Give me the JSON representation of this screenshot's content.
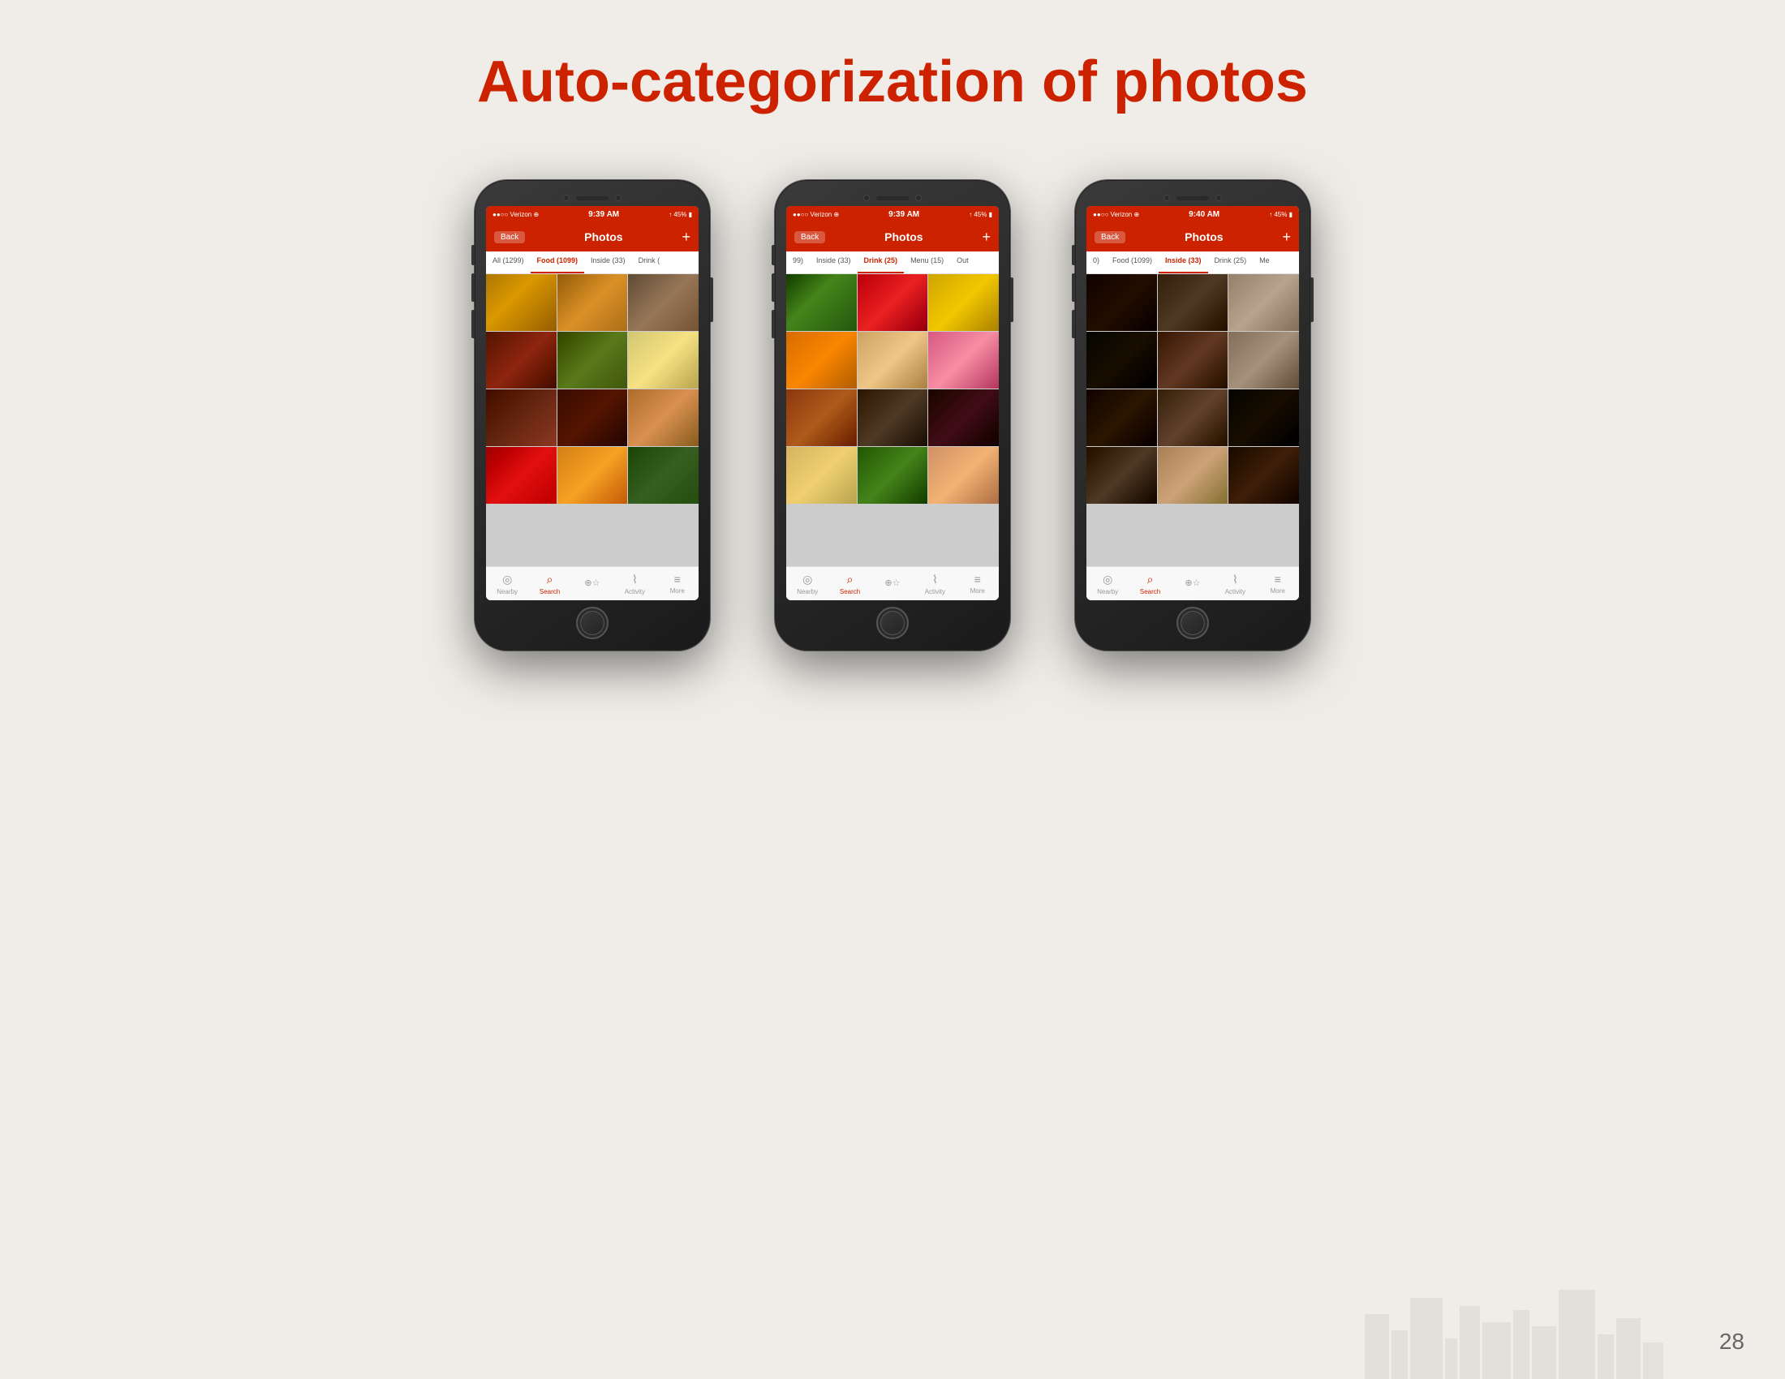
{
  "title": "Auto-categorization of photos",
  "page_number": "28",
  "phones": [
    {
      "id": "phone1",
      "status": {
        "carrier": "●●○○ Verizon ⊕",
        "time": "9:39 AM",
        "battery": "↑ 45% □"
      },
      "nav": {
        "back": "Back",
        "title": "Photos",
        "plus": "+"
      },
      "active_tab": "Food (1099)",
      "tabs": [
        "All (1299)",
        "Food (1099)",
        "Inside (33)",
        "Drink ("
      ],
      "bottom_tabs": [
        {
          "label": "Nearby",
          "icon": "◎",
          "active": false
        },
        {
          "label": "Search",
          "icon": "⌕",
          "active": true
        },
        {
          "label": "",
          "icon": "☆",
          "active": false
        },
        {
          "label": "Activity",
          "icon": "⌇",
          "active": false
        },
        {
          "label": "More",
          "icon": "≡",
          "active": false
        }
      ],
      "grid_classes": [
        "p-food1",
        "p-food2",
        "p-food3",
        "p-food4",
        "p-food5",
        "p-food6",
        "p-food7",
        "p-food8",
        "p-food9",
        "p-food10",
        "p-food11",
        "p-food12"
      ]
    },
    {
      "id": "phone2",
      "status": {
        "carrier": "●●○○ Verizon ⊕",
        "time": "9:39 AM",
        "battery": "↑ 45% □"
      },
      "nav": {
        "back": "Back",
        "title": "Photos",
        "plus": "+"
      },
      "active_tab": "Drink (25)",
      "tabs": [
        "99)",
        "Inside (33)",
        "Drink (25)",
        "Menu (15)",
        "Out"
      ],
      "bottom_tabs": [
        {
          "label": "Nearby",
          "icon": "◎",
          "active": false
        },
        {
          "label": "Search",
          "icon": "⌕",
          "active": true
        },
        {
          "label": "",
          "icon": "☆",
          "active": false
        },
        {
          "label": "Activity",
          "icon": "⌇",
          "active": false
        },
        {
          "label": "More",
          "icon": "≡",
          "active": false
        }
      ],
      "grid_classes": [
        "p-drink1",
        "p-drink2",
        "p-drink3",
        "p-drink4",
        "p-drink5",
        "p-drink6",
        "p-drink7",
        "p-drink8",
        "p-drink9",
        "p-drink10",
        "p-drink11",
        "p-drink12"
      ]
    },
    {
      "id": "phone3",
      "status": {
        "carrier": "●●○○ Verizon ⊕",
        "time": "9:40 AM",
        "battery": "↑ 45% □"
      },
      "nav": {
        "back": "Back",
        "title": "Photos",
        "plus": "+"
      },
      "active_tab": "Inside (33)",
      "tabs": [
        "0)",
        "Food (1099)",
        "Inside (33)",
        "Drink (25)",
        "Me"
      ],
      "bottom_tabs": [
        {
          "label": "Nearby",
          "icon": "◎",
          "active": false
        },
        {
          "label": "Search",
          "icon": "⌕",
          "active": true
        },
        {
          "label": "",
          "icon": "☆",
          "active": false
        },
        {
          "label": "Activity",
          "icon": "⌇",
          "active": false
        },
        {
          "label": "More",
          "icon": "≡",
          "active": false
        }
      ],
      "grid_classes": [
        "p-inside1",
        "p-inside2",
        "p-inside3",
        "p-inside4",
        "p-inside5",
        "p-inside6",
        "p-inside7",
        "p-inside8",
        "p-inside9",
        "p-inside10",
        "p-inside11",
        "p-inside12"
      ]
    }
  ]
}
